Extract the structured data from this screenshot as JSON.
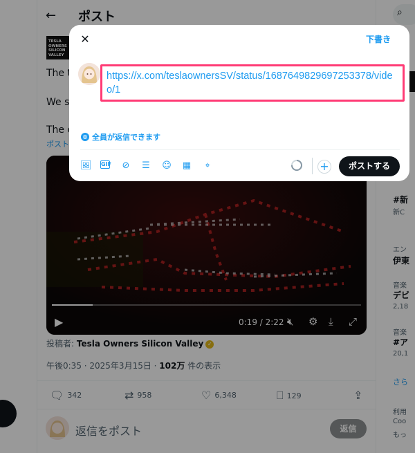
{
  "header": {
    "back_icon": "back-arrow-icon",
    "title": "ポスト"
  },
  "post": {
    "author_logo_text": "TESLA OWNERS SILICON VALLEY",
    "lines": [
      "The t",
      "We st",
      "The c"
    ],
    "link_text": "ポスト",
    "video": {
      "elapsed": "0:19",
      "duration": "2:22",
      "time_label": "0:19 / 2:22",
      "progress": 0.133
    },
    "poster_prefix": "投稿者: ",
    "poster_name": "Tesla Owners Silicon Valley",
    "time": "午後0:35 · 2025年3月15日 · ",
    "views_count": "102万",
    "views_suffix": " 件の表示",
    "stats": {
      "replies": "342",
      "reposts": "958",
      "likes": "6,348",
      "bookmarks": "129"
    },
    "reply_placeholder": "返信をポスト",
    "reply_button": "返信"
  },
  "right_column": {
    "items": [
      {
        "kind": "bold",
        "text": "#新"
      },
      {
        "kind": "small",
        "text": "新C"
      },
      {
        "kind": "small",
        "text": "エン"
      },
      {
        "kind": "bold",
        "text": "伊東"
      },
      {
        "kind": "small",
        "text": "音楽"
      },
      {
        "kind": "bold",
        "text": "デビ"
      },
      {
        "kind": "small",
        "text": "2,18"
      },
      {
        "kind": "small",
        "text": "音楽"
      },
      {
        "kind": "bold",
        "text": "#ア"
      },
      {
        "kind": "small",
        "text": "20,1"
      },
      {
        "kind": "link",
        "text": "さら"
      },
      {
        "kind": "small",
        "text": "利用"
      },
      {
        "kind": "small",
        "text": "Coo"
      },
      {
        "kind": "small",
        "text": "もっ"
      }
    ]
  },
  "composer": {
    "close_icon": "close-icon",
    "drafts_label": "下書き",
    "text": "https://x.com/teslaownersSV/status/1687649829697253378/video/1",
    "reply_setting": "全員が返信できます",
    "tools": [
      "image-icon",
      "gif-icon",
      "grok-icon",
      "poll-icon",
      "emoji-icon",
      "schedule-icon",
      "location-icon"
    ],
    "post_button": "ポストする",
    "highlight_color": "#ff3b75",
    "accent_color": "#1d9bf0"
  }
}
